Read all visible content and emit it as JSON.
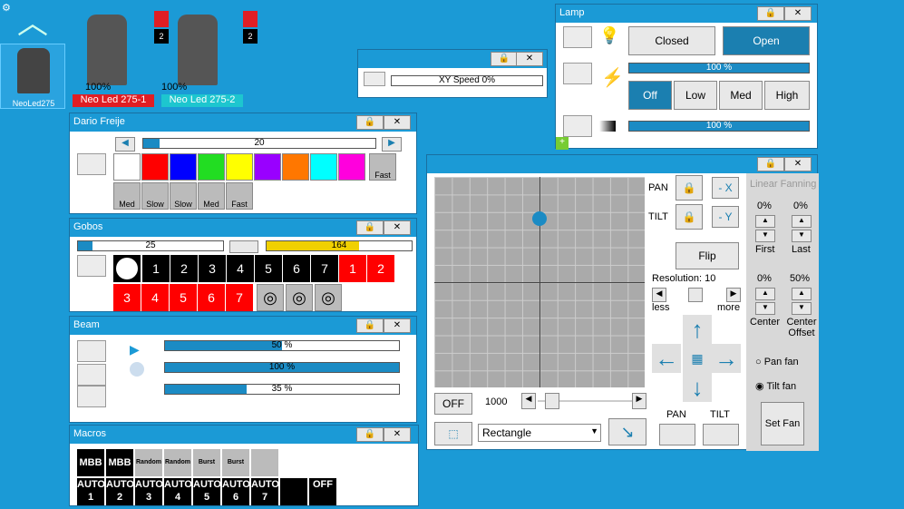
{
  "fixtures": [
    {
      "pct": "100%",
      "label": "Neo Led 275-1",
      "badge": "2",
      "color": "#e01e24"
    },
    {
      "pct": "100%",
      "label": "Neo Led 275-2",
      "badge": "2",
      "color": "#1dc6cf"
    }
  ],
  "sidebar": {
    "fixture_label": "NeoLed275"
  },
  "xyspeed": {
    "label": "XY Speed",
    "value": "0%"
  },
  "lamp": {
    "title": "Lamp",
    "closed": "Closed",
    "open": "Open",
    "bar1": "100 %",
    "bar2": "100 %",
    "bar1_level": 1.0,
    "bar2_level": 1.0,
    "modes": [
      "Off",
      "Low",
      "Med",
      "High"
    ]
  },
  "color": {
    "title": "Dario Freije",
    "value": "20",
    "level": 0.07,
    "swatches": [
      "#ffffff",
      "#ff0000",
      "#0000ff",
      "#22dd22",
      "#ffff00",
      "#9900ff",
      "#ff7700",
      "#00ffff",
      "#ff00dd"
    ],
    "fast": "Fast",
    "wheels": [
      "Med",
      "Slow",
      "Slow",
      "Med",
      "Fast"
    ]
  },
  "gobos": {
    "title": "Gobos",
    "bar1": "25",
    "bar1_level": 0.1,
    "bar2": "164",
    "bar2_level": 0.64,
    "row1": [
      "1",
      "2",
      "3",
      "4",
      "5",
      "6",
      "7",
      "1",
      "2"
    ],
    "row2": [
      "3",
      "4",
      "5",
      "6",
      "7"
    ]
  },
  "beam": {
    "title": "Beam",
    "bars": [
      {
        "text": "50 %",
        "level": 0.5
      },
      {
        "text": "100 %",
        "level": 1.0
      },
      {
        "text": "35 %",
        "level": 0.35
      }
    ]
  },
  "macros": {
    "title": "Macros",
    "row1": [
      "MBB",
      "MBB",
      "Random",
      "Random",
      "Burst",
      "Burst",
      ""
    ],
    "row2": [
      "AUTO 1",
      "AUTO 2",
      "AUTO 3",
      "AUTO 4",
      "AUTO 5",
      "AUTO 6",
      "AUTO 7",
      "",
      "OFF"
    ]
  },
  "xy": {
    "pan": "PAN",
    "tilt": "TILT",
    "x": "- X",
    "y": "- Y",
    "flip": "Flip",
    "resolution": "Resolution: 10",
    "less": "less",
    "more": "more",
    "off": "OFF",
    "val": "1000",
    "shape": "Rectangle",
    "pan_lbl": "PAN",
    "tilt_lbl": "TILT"
  },
  "fan": {
    "title": "Linear Fanning",
    "first_pct": "0%",
    "last_pct": "0%",
    "first": "First",
    "last": "Last",
    "center_pct": "0%",
    "offset_pct": "50%",
    "center": "Center",
    "offset": "Center Offset",
    "panfan": "Pan fan",
    "tiltfan": "Tilt fan",
    "setfan": "Set Fan"
  }
}
